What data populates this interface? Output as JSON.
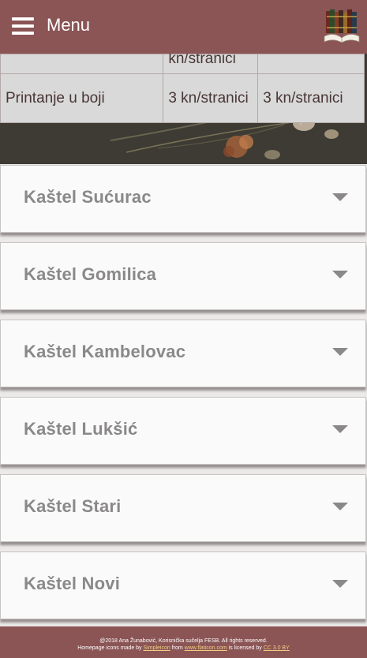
{
  "header": {
    "menu_label": "Menu",
    "menu_icon": "hamburger-menu-icon",
    "logo_icon": "books-logo-icon"
  },
  "price_table": {
    "rows": [
      {
        "cells": [
          "",
          "kn/stranici",
          ""
        ]
      },
      {
        "cells": [
          "Printanje u boji",
          "3 kn/stranici",
          "3 kn/stranici"
        ]
      }
    ]
  },
  "locations": [
    {
      "name": "Kaštel Sućurac"
    },
    {
      "name": "Kaštel Gomilica"
    },
    {
      "name": "Kaštel Kambelovac"
    },
    {
      "name": "Kaštel Lukšić"
    },
    {
      "name": "Kaštel Stari"
    },
    {
      "name": "Kaštel Novi"
    }
  ],
  "footer": {
    "line1": "@2018 Ana Žunabović, Korisnička sučelja FESB. All rights reserved.",
    "line2_pre": "Homepage icons made by",
    "link1": "Simpleicon",
    "line2_mid1": "from",
    "link2": "www.flaticon.com",
    "line2_mid2": "is licensed by",
    "link3": "CC 3.0 BY"
  },
  "colors": {
    "brand": "#8b5455",
    "accordion_text": "#8a8889",
    "table_bg": "#d9d9d9",
    "footer_link": "#f0d080"
  }
}
